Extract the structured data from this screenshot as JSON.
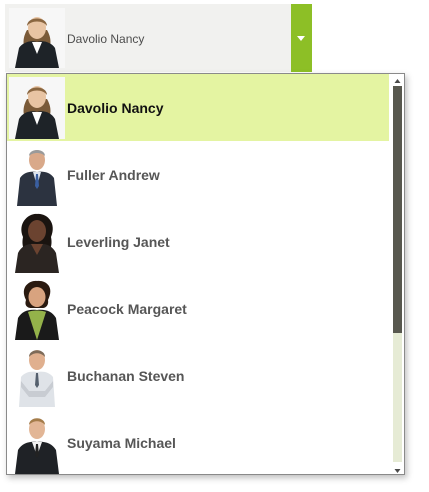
{
  "combo": {
    "selected_name": "Davolio Nancy",
    "accent": "#8dbf26"
  },
  "list": {
    "items": [
      {
        "name": "Davolio Nancy",
        "selected": true
      },
      {
        "name": "Fuller Andrew",
        "selected": false
      },
      {
        "name": "Leverling Janet",
        "selected": false
      },
      {
        "name": "Peacock Margaret",
        "selected": false
      },
      {
        "name": "Buchanan Steven",
        "selected": false
      },
      {
        "name": "Suyama Michael",
        "selected": false
      }
    ],
    "selected_color": "#e4f4a2"
  },
  "scrollbar": {
    "up_icon": "triangle-up-icon",
    "down_icon": "triangle-down-icon",
    "thumb_fraction": 0.66
  }
}
